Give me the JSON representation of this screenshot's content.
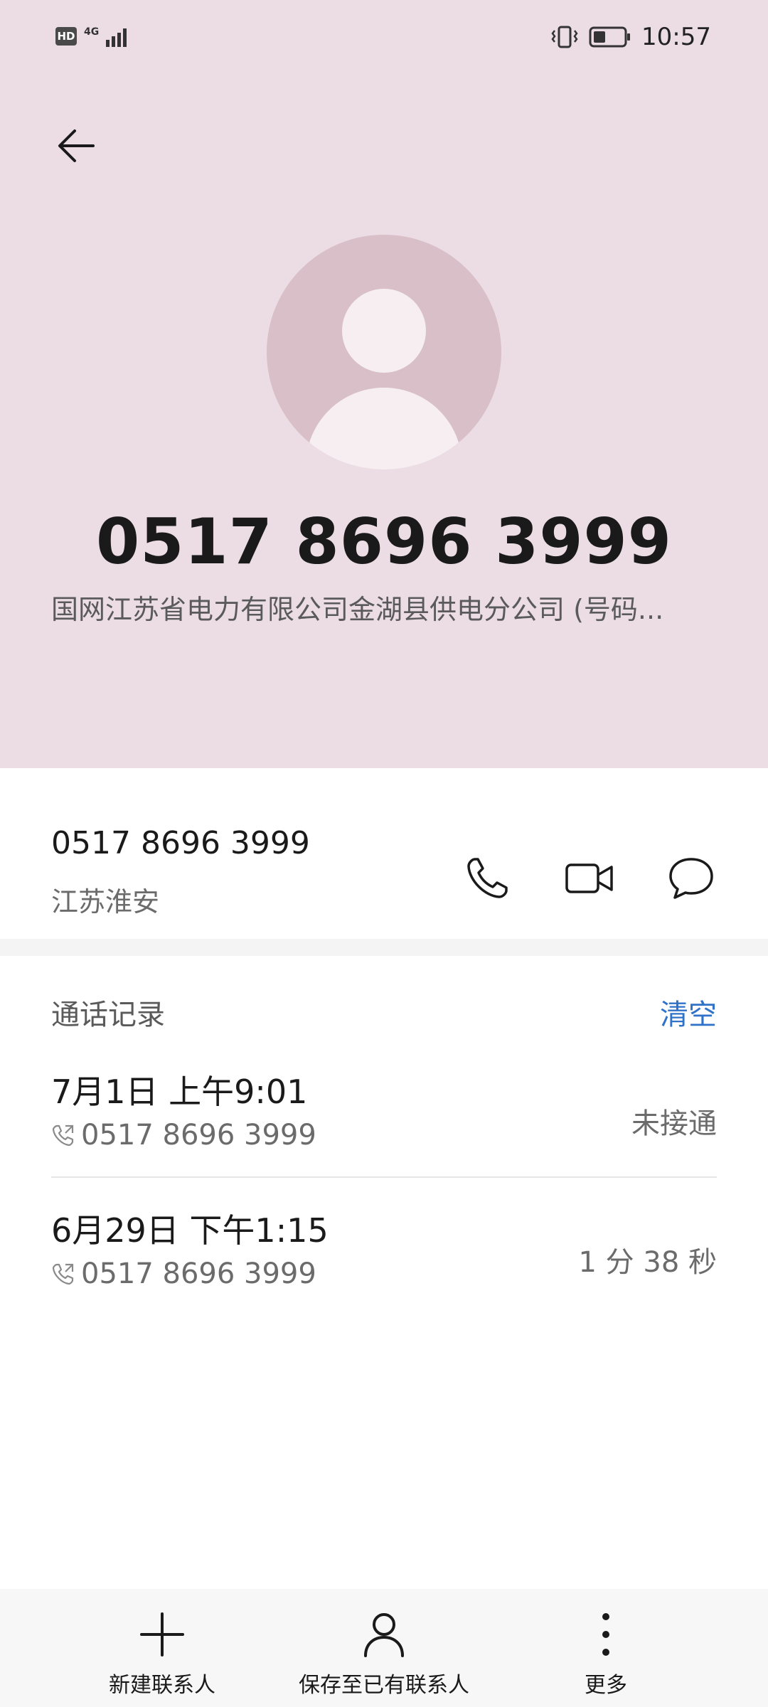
{
  "status_bar": {
    "hd": "HD",
    "network": "4G",
    "time": "10:57"
  },
  "contact": {
    "number": "0517 8696 3999",
    "org": "国网江苏省电力有限公司金湖县供电分公司 (号码..."
  },
  "number_row": {
    "number": "0517 8696 3999",
    "location": "江苏淮安"
  },
  "call_log": {
    "title": "通话记录",
    "clear_label": "清空",
    "items": [
      {
        "datetime": "7月1日 上午9:01",
        "number": "0517 8696 3999",
        "status": "未接通"
      },
      {
        "datetime": "6月29日 下午1:15",
        "number": "0517 8696 3999",
        "status": "1 分 38 秒"
      }
    ]
  },
  "bottom_bar": {
    "new_contact": "新建联系人",
    "save_existing": "保存至已有联系人",
    "more": "更多"
  },
  "colors": {
    "header_bg": "#ecdde4",
    "accent_blue": "#2f72c8"
  }
}
